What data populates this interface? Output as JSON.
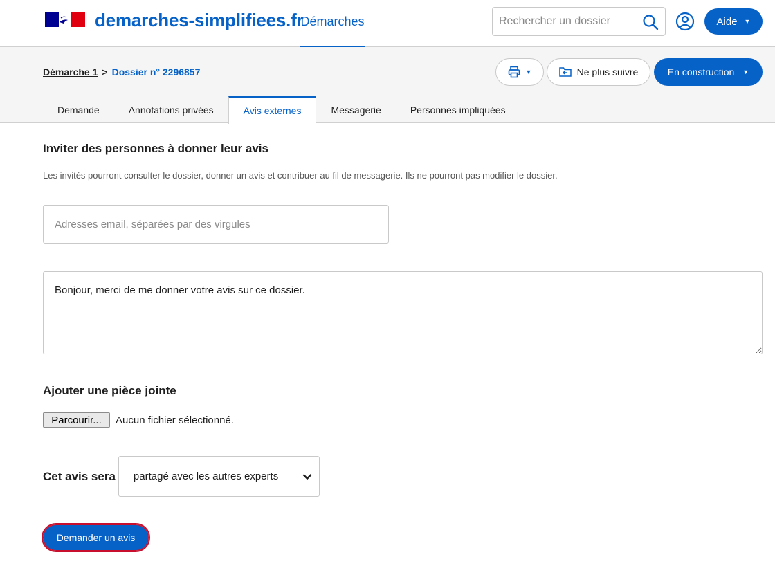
{
  "header": {
    "site_name": "demarches-simplifiees.fr",
    "nav_demarches": "Démarches",
    "search_placeholder": "Rechercher un dossier",
    "aide_label": "Aide"
  },
  "subheader": {
    "breadcrumb": {
      "procedure": "Démarche 1",
      "separator": ">",
      "dossier": "Dossier n° 2296857"
    },
    "follow_label": "Ne plus suivre",
    "status_label": "En construction",
    "tabs": [
      {
        "label": "Demande",
        "active": false
      },
      {
        "label": "Annotations privées",
        "active": false
      },
      {
        "label": "Avis externes",
        "active": true
      },
      {
        "label": "Messagerie",
        "active": false
      },
      {
        "label": "Personnes impliquées",
        "active": false
      }
    ]
  },
  "form": {
    "title": "Inviter des personnes à donner leur avis",
    "description": "Les invités pourront consulter le dossier, donner un avis et contribuer au fil de messagerie. Ils ne pourront pas modifier le dossier.",
    "email_placeholder": "Adresses email, séparées par des virgules",
    "message_value": "Bonjour, merci de me donner votre avis sur ce dossier.",
    "attachment_title": "Ajouter une pièce jointe",
    "browse_label": "Parcourir...",
    "file_status": "Aucun fichier sélectionné.",
    "share_label": "Cet avis sera",
    "share_selected": "partagé avec les autres experts",
    "submit_label": "Demander un avis"
  },
  "colors": {
    "accent": "#0762c8",
    "focus_outline": "#c8102e",
    "subheader_bg": "#f5f5f5"
  }
}
